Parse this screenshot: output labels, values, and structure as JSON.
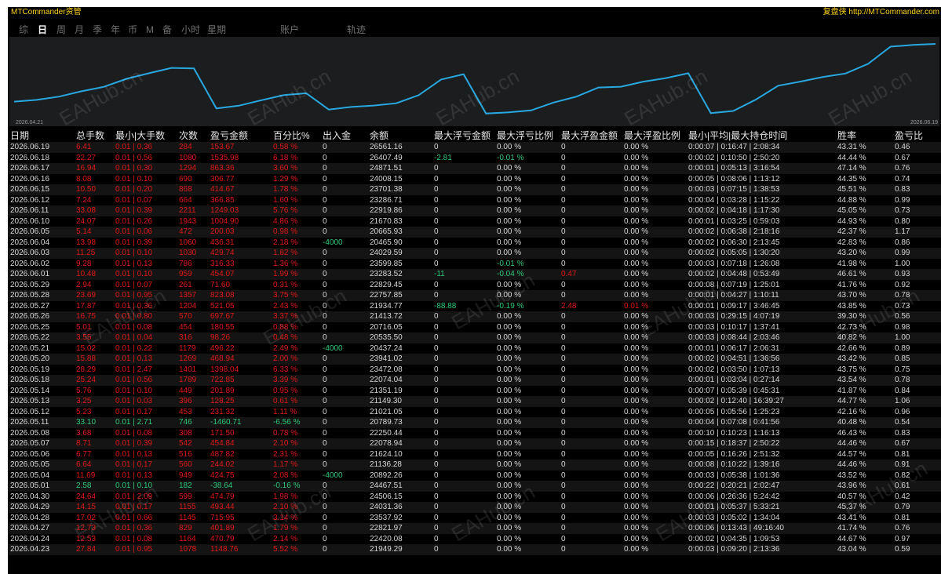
{
  "app": {
    "title": "MTCommander资管",
    "brand": "复盘侠 http://MTCommander.com"
  },
  "tabs": [
    "综",
    "日",
    "周",
    "月",
    "季",
    "年",
    "币",
    "M",
    "备",
    "小时",
    "星期",
    "账户",
    "轨迹"
  ],
  "active_tab": "日",
  "chart": {
    "start_date": "2026.04.21",
    "end_date": "2026.06.19",
    "line_color": "#29a8e0",
    "balance": [
      21500,
      21650,
      21949.29,
      22420.08,
      22821.97,
      23537.92,
      24031.36,
      24506.15,
      24467.51,
      20892.26,
      21136.28,
      21624.1,
      22078.94,
      22250.44,
      20789.73,
      21021.05,
      21149.3,
      21351.19,
      22074.04,
      23472.08,
      23941.02,
      20437.24,
      20535.5,
      20716.05,
      21413.72,
      21934.77,
      22757.85,
      22829.45,
      23283.52,
      23599.85,
      24029.59,
      20465.9,
      20665.93,
      21670.83,
      22919.86,
      23286.71,
      23701.38,
      24008.15,
      24871.51,
      26407.49,
      26561.16,
      26650
    ]
  },
  "watermark": "EAHub.cn",
  "columns": [
    "日期",
    "总手数",
    "最小|大手数",
    "次数",
    "盈亏金额",
    "百分比%",
    "出入金",
    "余额",
    "最大浮亏金额",
    "最大浮亏比例",
    "最大浮盈金额",
    "最大浮盈比例",
    "最小|平均|最大持仓时间",
    "胜率",
    "盈亏比"
  ],
  "rows": [
    [
      "2026.06.19",
      "6.41",
      "0.01 | 0.36",
      "284",
      "153.67",
      "0.58 %",
      "0",
      "26561.16",
      "0",
      "0.00 %",
      "0",
      "0.00 %",
      "0:00:07 | 0:16:47 | 2:08:34",
      "43.31 %",
      "0.46"
    ],
    [
      "2026.06.18",
      "22.27",
      "0.01 | 0.56",
      "1080",
      "1535.98",
      "6.18 %",
      "0",
      "26407.49",
      "-2.81",
      "-0.01 %",
      "0",
      "0.00 %",
      "0:00:02 | 0:10:50 | 2:50:20",
      "44.44 %",
      "0.67"
    ],
    [
      "2026.06.17",
      "16.94",
      "0.01 | 0.30",
      "1294",
      "863.36",
      "3.60 %",
      "0",
      "24871.51",
      "0",
      "0.00 %",
      "0",
      "0.00 %",
      "0:00:01 | 0:05:13 | 3:16:54",
      "47.14 %",
      "0.76"
    ],
    [
      "2026.06.16",
      "8.08",
      "0.01 | 0.10",
      "690",
      "306.77",
      "1.29 %",
      "0",
      "24008.15",
      "0",
      "0.00 %",
      "0",
      "0.00 %",
      "0:00:05 | 0:08:06 | 1:13:12",
      "44.35 %",
      "0.74"
    ],
    [
      "2026.06.15",
      "10.50",
      "0.01 | 0.20",
      "868",
      "414.67",
      "1.78 %",
      "0",
      "23701.38",
      "0",
      "0.00 %",
      "0",
      "0.00 %",
      "0:00:03 | 0:07:15 | 1:38:53",
      "45.51 %",
      "0.83"
    ],
    [
      "2026.06.12",
      "7.24",
      "0.01 | 0.07",
      "664",
      "366.85",
      "1.60 %",
      "0",
      "23286.71",
      "0",
      "0.00 %",
      "0",
      "0.00 %",
      "0:00:04 | 0:03:28 | 1:15:22",
      "44.88 %",
      "0.99"
    ],
    [
      "2026.06.11",
      "33.08",
      "0.01 | 0.39",
      "2211",
      "1249.03",
      "5.76 %",
      "0",
      "22919.86",
      "0",
      "0.00 %",
      "0",
      "0.00 %",
      "0:00:02 | 0:04:18 | 1:17:30",
      "45.05 %",
      "0.73"
    ],
    [
      "2026.06.10",
      "24.07",
      "0.01 | 0.26",
      "1943",
      "1004.90",
      "4.86 %",
      "0",
      "21670.83",
      "0",
      "0.00 %",
      "0",
      "0.00 %",
      "0:00:01 | 0:03:25 | 0:59:03",
      "44.93 %",
      "0.80"
    ],
    [
      "2026.06.05",
      "5.14",
      "0.01 | 0.06",
      "472",
      "200.03",
      "0.98 %",
      "0",
      "20665.93",
      "0",
      "0.00 %",
      "0",
      "0.00 %",
      "0:00:02 | 0:06:38 | 2:18:16",
      "42.37 %",
      "1.17"
    ],
    [
      "2026.06.04",
      "13.98",
      "0.01 | 0.39",
      "1060",
      "436.31",
      "2.18 %",
      "-4000",
      "20465.90",
      "0",
      "0.00 %",
      "0",
      "0.00 %",
      "0:00:02 | 0:06:30 | 2:13:45",
      "42.83 %",
      "0.86"
    ],
    [
      "2026.06.03",
      "11.25",
      "0.01 | 0.10",
      "1030",
      "429.74",
      "1.82 %",
      "0",
      "24029.59",
      "0",
      "0.00 %",
      "0",
      "0.00 %",
      "0:00:02 | 0:05:05 | 1:30:20",
      "43.20 %",
      "0.99"
    ],
    [
      "2026.06.02",
      "9.28",
      "0.01 | 0.13",
      "786",
      "316.33",
      "1.36 %",
      "0",
      "23599.85",
      "0",
      "-0.01 %",
      "0",
      "0.00 %",
      "0:00:03 | 0:07:18 | 1:26:08",
      "41.98 %",
      "1.00"
    ],
    [
      "2026.06.01",
      "10.48",
      "0.01 | 0.10",
      "959",
      "454.07",
      "1.99 %",
      "0",
      "23283.52",
      "-11",
      "-0.04 %",
      "0.47",
      "0.00 %",
      "0:00:02 | 0:04:48 | 0:53:49",
      "46.61 %",
      "0.93"
    ],
    [
      "2026.05.29",
      "2.94",
      "0.01 | 0.07",
      "261",
      "71.60",
      "0.31 %",
      "0",
      "22829.45",
      "0",
      "0.00 %",
      "0",
      "0.00 %",
      "0:00:08 | 0:07:19 | 1:25:01",
      "41.76 %",
      "0.92"
    ],
    [
      "2026.05.28",
      "23.69",
      "0.01 | 0.95",
      "1357",
      "823.08",
      "3.75 %",
      "0",
      "22757.85",
      "0",
      "0.00 %",
      "0",
      "0.00 %",
      "0:00:01 | 0:04:27 | 1:10:11",
      "43.70 %",
      "0.78"
    ],
    [
      "2026.05.27",
      "17.87",
      "0.01 | 0.36",
      "1204",
      "521.05",
      "2.43 %",
      "0",
      "21934.77",
      "-88.88",
      "-0.19 %",
      "2.48",
      "0.01 %",
      "0:00:01 | 0:09:17 | 3:46:45",
      "43.85 %",
      "0.73"
    ],
    [
      "2026.05.26",
      "16.75",
      "0.01 | 0.80",
      "570",
      "697.67",
      "3.37 %",
      "0",
      "21413.72",
      "0",
      "0.00 %",
      "0",
      "0.00 %",
      "0:00:03 | 0:29:15 | 4:07:19",
      "39.30 %",
      "0.56"
    ],
    [
      "2026.05.25",
      "5.01",
      "0.01 | 0.08",
      "454",
      "180.55",
      "0.88 %",
      "0",
      "20716.05",
      "0",
      "0.00 %",
      "0",
      "0.00 %",
      "0:00:03 | 0:10:17 | 1:37:41",
      "42.73 %",
      "0.98"
    ],
    [
      "2026.05.22",
      "3.55",
      "0.01 | 0.04",
      "316",
      "98.26",
      "0.48 %",
      "0",
      "20535.50",
      "0",
      "0.00 %",
      "0",
      "0.00 %",
      "0:00:03 | 0:08:44 | 2:03:46",
      "40.82 %",
      "1.00"
    ],
    [
      "2026.05.21",
      "15.02",
      "0.01 | 0.22",
      "1179",
      "496.22",
      "2.49 %",
      "-4000",
      "20437.24",
      "0",
      "0.00 %",
      "0",
      "0.00 %",
      "0:00:01 | 0:06:17 | 2:06:31",
      "42.66 %",
      "0.89"
    ],
    [
      "2026.05.20",
      "15.88",
      "0.01 | 0.13",
      "1269",
      "468.94",
      "2.00 %",
      "0",
      "23941.02",
      "0",
      "0.00 %",
      "0",
      "0.00 %",
      "0:00:02 | 0:04:51 | 1:36:56",
      "43.42 %",
      "0.85"
    ],
    [
      "2026.05.19",
      "28.29",
      "0.01 | 2.47",
      "1401",
      "1398.04",
      "6.33 %",
      "0",
      "23472.08",
      "0",
      "0.00 %",
      "0",
      "0.00 %",
      "0:00:02 | 0:03:50 | 1:07:13",
      "43.75 %",
      "0.75"
    ],
    [
      "2026.05.18",
      "25.24",
      "0.01 | 0.56",
      "1789",
      "722.85",
      "3.39 %",
      "0",
      "22074.04",
      "0",
      "0.00 %",
      "0",
      "0.00 %",
      "0:00:01 | 0:03:04 | 0:27:14",
      "43.54 %",
      "0.78"
    ],
    [
      "2026.05.14",
      "5.76",
      "0.01 | 0.10",
      "449",
      "201.89",
      "0.95 %",
      "0",
      "21351.19",
      "0",
      "0.00 %",
      "0",
      "0.00 %",
      "0:00:07 | 0:05:39 | 0:45:31",
      "41.87 %",
      "0.84"
    ],
    [
      "2026.05.13",
      "3.25",
      "0.01 | 0.03",
      "396",
      "128.25",
      "0.61 %",
      "0",
      "21149.30",
      "0",
      "0.00 %",
      "0",
      "0.00 %",
      "0:00:02 | 0:12:40 | 16:39:27",
      "44.77 %",
      "1.06"
    ],
    [
      "2026.05.12",
      "5.23",
      "0.01 | 0.17",
      "453",
      "231.32",
      "1.11 %",
      "0",
      "21021.05",
      "0",
      "0.00 %",
      "0",
      "0.00 %",
      "0:00:05 | 0:05:56 | 1:25:23",
      "42.16 %",
      "0.96"
    ],
    [
      "2026.05.11",
      "33.10",
      "0.01 | 2.71",
      "746",
      "-1460.71",
      "-6.56 %",
      "0",
      "20789.73",
      "0",
      "0.00 %",
      "0",
      "0.00 %",
      "0:00:04 | 0:07:08 | 0:41:56",
      "40.48 %",
      "0.54"
    ],
    [
      "2026.05.08",
      "3.68",
      "0.01 | 0.08",
      "308",
      "171.50",
      "0.78 %",
      "0",
      "22250.44",
      "0",
      "0.00 %",
      "0",
      "0.00 %",
      "0:00:10 | 0:10:23 | 1:16:13",
      "46.43 %",
      "0.83"
    ],
    [
      "2026.05.07",
      "8.71",
      "0.01 | 0.39",
      "542",
      "454.84",
      "2.10 %",
      "0",
      "22078.94",
      "0",
      "0.00 %",
      "0",
      "0.00 %",
      "0:00:15 | 0:18:37 | 2:50:22",
      "44.46 %",
      "0.67"
    ],
    [
      "2026.05.06",
      "6.77",
      "0.01 | 0.13",
      "516",
      "487.82",
      "2.31 %",
      "0",
      "21624.10",
      "0",
      "0.00 %",
      "0",
      "0.00 %",
      "0:00:05 | 0:16:26 | 2:51:32",
      "44.57 %",
      "0.81"
    ],
    [
      "2026.05.05",
      "6.64",
      "0.01 | 0.17",
      "560",
      "244.02",
      "1.17 %",
      "0",
      "21136.28",
      "0",
      "0.00 %",
      "0",
      "0.00 %",
      "0:00:08 | 0:10:22 | 1:39:16",
      "44.46 %",
      "0.91"
    ],
    [
      "2026.05.04",
      "11.69",
      "0.01 | 0.13",
      "949",
      "424.75",
      "2.08 %",
      "-4000",
      "20892.26",
      "0",
      "0.00 %",
      "0",
      "0.00 %",
      "0:00:03 | 0:05:38 | 1:01:36",
      "43.52 %",
      "0.82"
    ],
    [
      "2026.05.01",
      "2.58",
      "0.01 | 0.10",
      "182",
      "-38.64",
      "-0.16 %",
      "0",
      "24467.51",
      "0",
      "0.00 %",
      "0",
      "0.00 %",
      "0:00:22 | 0:20:21 | 2:02:47",
      "43.96 %",
      "0.61"
    ],
    [
      "2026.04.30",
      "24.64",
      "0.01 | 2.09",
      "599",
      "474.79",
      "1.98 %",
      "0",
      "24506.15",
      "0",
      "0.00 %",
      "0",
      "0.00 %",
      "0:00:06 | 0:26:36 | 5:24:42",
      "40.57 %",
      "0.42"
    ],
    [
      "2026.04.29",
      "14.15",
      "0.01 | 0.17",
      "1155",
      "493.44",
      "2.10 %",
      "0",
      "24031.36",
      "0",
      "0.00 %",
      "0",
      "0.00 %",
      "0:00:01 | 0:05:37 | 5:33:21",
      "45.37 %",
      "0.79"
    ],
    [
      "2026.04.28",
      "17.02",
      "0.01 | 0.66",
      "1145",
      "715.95",
      "3.14 %",
      "0",
      "23537.92",
      "0",
      "0.00 %",
      "0",
      "0.00 %",
      "0:00:03 | 0:05:02 | 1:34:04",
      "43.41 %",
      "0.81"
    ],
    [
      "2026.04.27",
      "12.73",
      "0.01 | 0.36",
      "829",
      "401.89",
      "1.79 %",
      "0",
      "22821.97",
      "0",
      "0.00 %",
      "0",
      "0.00 %",
      "0:00:06 | 0:13:43 | 49:16:40",
      "41.74 %",
      "0.76"
    ],
    [
      "2026.04.24",
      "12.53",
      "0.01 | 0.08",
      "1164",
      "470.79",
      "2.14 %",
      "0",
      "22420.08",
      "0",
      "0.00 %",
      "0",
      "0.00 %",
      "0:00:02 | 0:04:35 | 1:09:53",
      "44.67 %",
      "0.97"
    ],
    [
      "2026.04.23",
      "27.84",
      "0.01 | 0.95",
      "1078",
      "1148.76",
      "5.52 %",
      "0",
      "21949.29",
      "0",
      "0.00 %",
      "0",
      "0.00 %",
      "0:00:03 | 0:09:20 | 2:13:36",
      "43.04 %",
      "0.59"
    ]
  ],
  "colors": {
    "profit": "#e01818",
    "loss": "#2ec87a",
    "neutral": "#d6d6d6",
    "title": "#ffd21a"
  }
}
